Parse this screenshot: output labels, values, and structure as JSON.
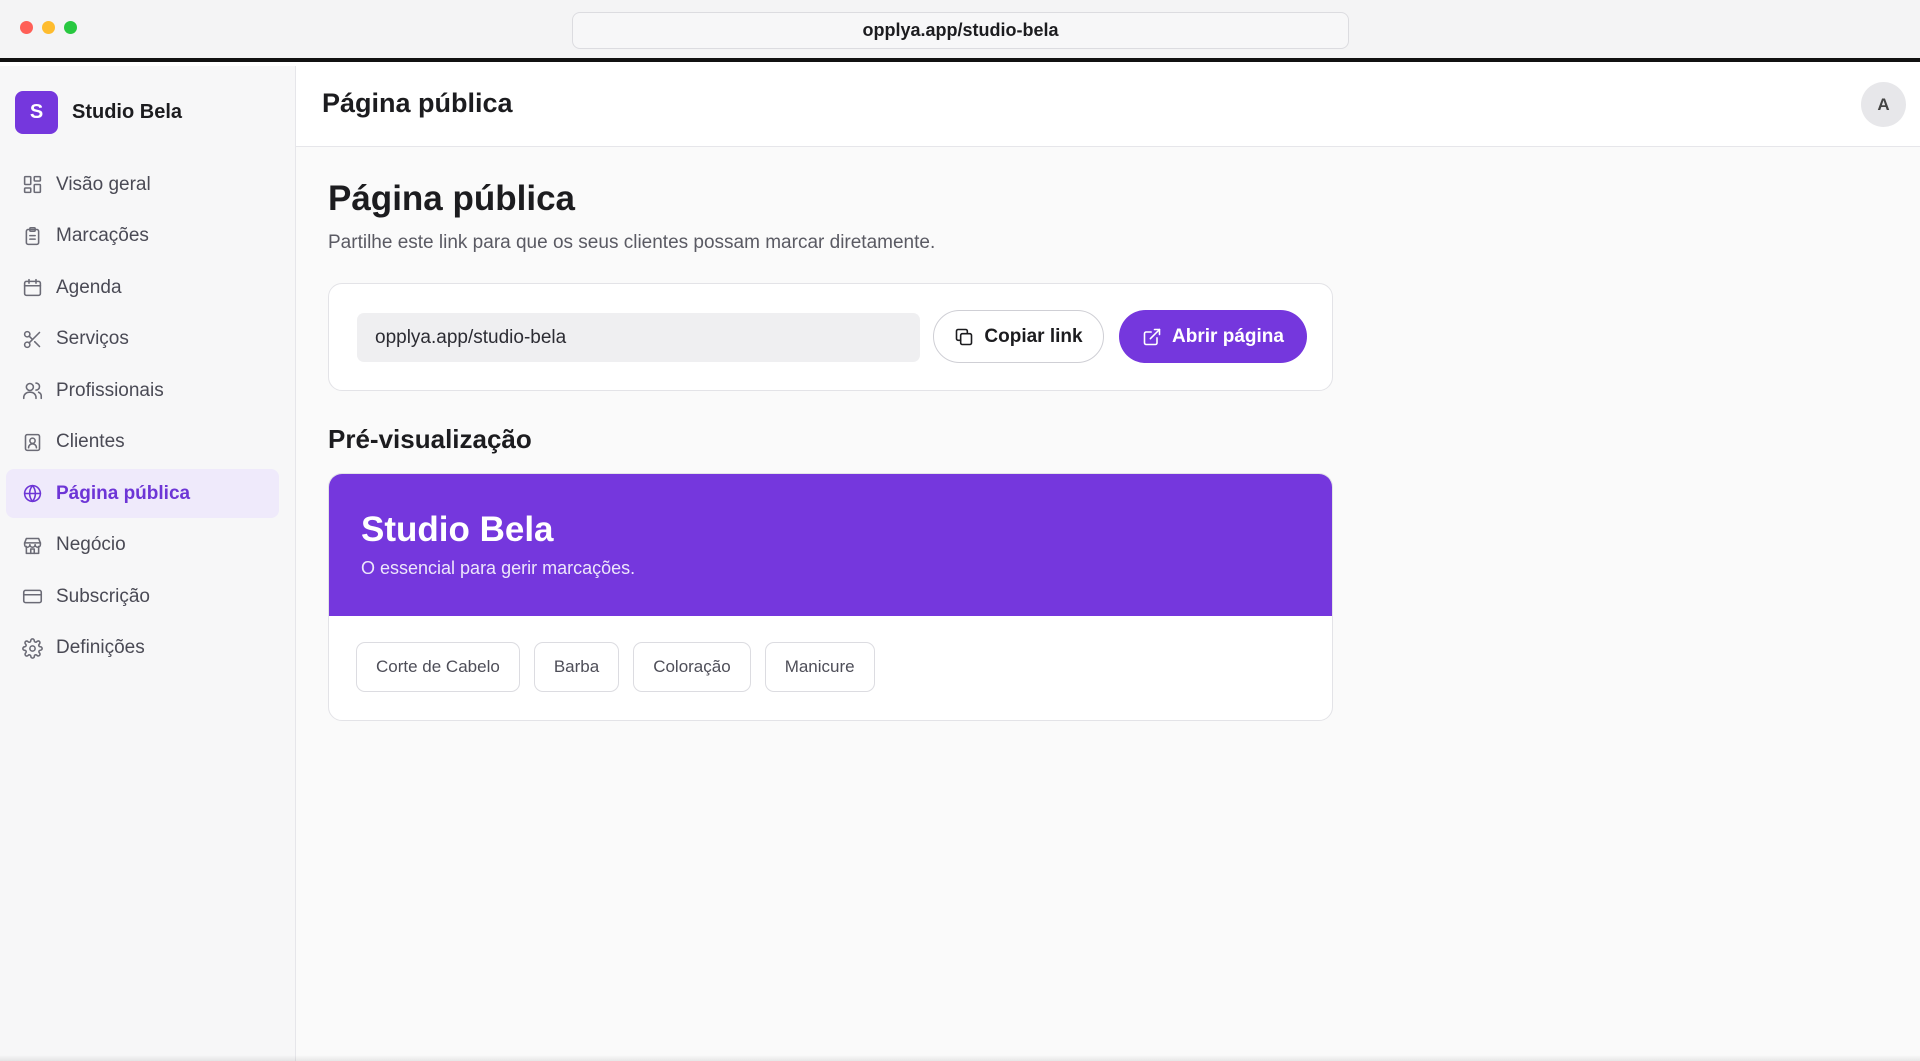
{
  "browser": {
    "url": "opplya.app/studio-bela",
    "traffic_lights": [
      "#ff5f57",
      "#febc2e",
      "#28c840"
    ]
  },
  "sidebar": {
    "brand_initial": "S",
    "brand_name": "Studio Bela",
    "items": [
      {
        "label": "Visão geral",
        "icon": "dashboard-icon"
      },
      {
        "label": "Marcações",
        "icon": "clipboard-icon"
      },
      {
        "label": "Agenda",
        "icon": "calendar-icon"
      },
      {
        "label": "Serviços",
        "icon": "scissors-icon"
      },
      {
        "label": "Profissionais",
        "icon": "users-icon"
      },
      {
        "label": "Clientes",
        "icon": "contact-card-icon"
      },
      {
        "label": "Página pública",
        "icon": "globe-icon",
        "active": true
      },
      {
        "label": "Negócio",
        "icon": "store-icon"
      },
      {
        "label": "Subscrição",
        "icon": "credit-card-icon"
      },
      {
        "label": "Definições",
        "icon": "gear-icon"
      }
    ]
  },
  "topbar": {
    "title": "Página pública",
    "avatar_initial": "A"
  },
  "main": {
    "heading": "Página pública",
    "subtitle": "Partilhe este link para que os seus clientes possam marcar diretamente.",
    "link_value": "opplya.app/studio-bela",
    "copy_label": "Copiar link",
    "open_label": "Abrir página",
    "preview_heading": "Pré-visualização",
    "preview": {
      "name": "Studio Bela",
      "tagline": "O essencial para gerir marcações.",
      "services": [
        "Corte de Cabelo",
        "Barba",
        "Coloração",
        "Manicure"
      ]
    }
  },
  "colors": {
    "accent": "#7537dd",
    "active_bg": "#efeafb"
  }
}
